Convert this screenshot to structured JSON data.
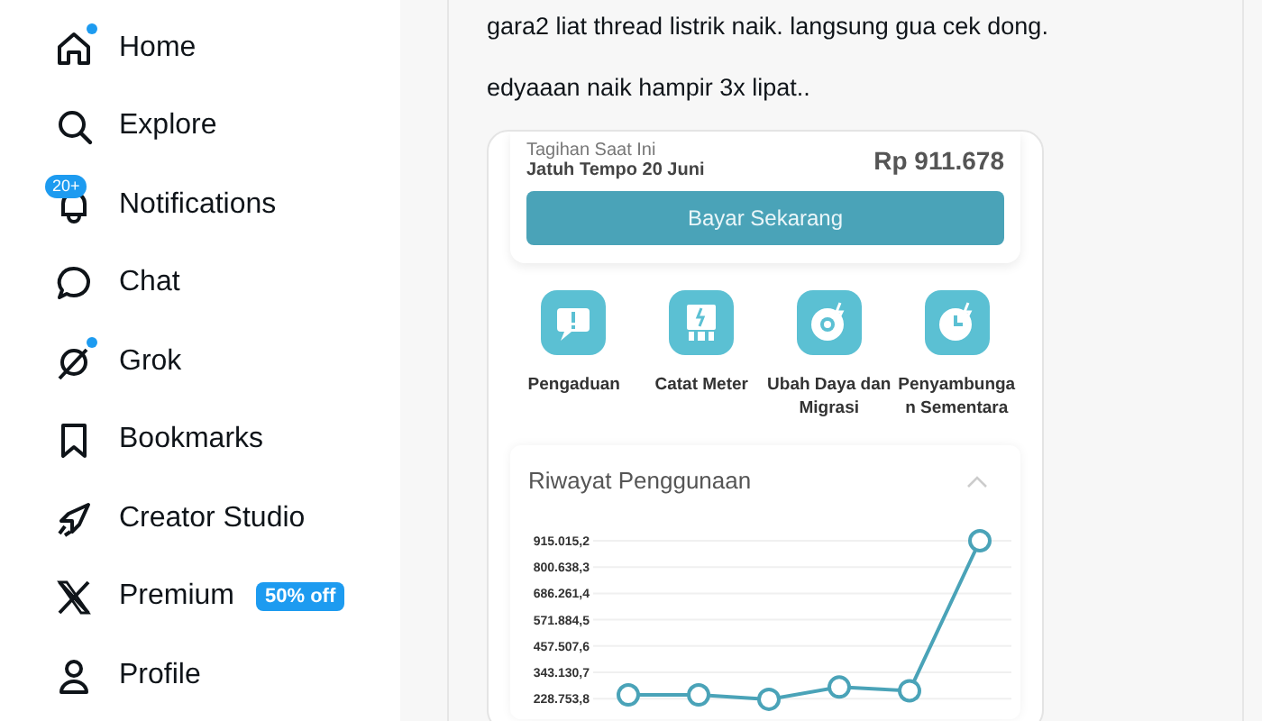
{
  "sidebar": {
    "items": [
      {
        "label": "Home",
        "dot": true
      },
      {
        "label": "Explore",
        "dot": false
      },
      {
        "label": "Notifications",
        "dot": false,
        "badge": "20+"
      },
      {
        "label": "Chat",
        "dot": false
      },
      {
        "label": "Grok",
        "dot": true
      },
      {
        "label": "Bookmarks",
        "dot": false
      },
      {
        "label": "Creator Studio",
        "dot": false
      },
      {
        "label": "Premium",
        "dot": false,
        "tag": "50% off"
      },
      {
        "label": "Profile",
        "dot": false
      }
    ]
  },
  "post": {
    "lines": [
      "gara2 liat thread listrik naik. langsung gua cek dong.",
      "edyaaan naik hampir 3x lipat.."
    ],
    "app_screenshot": {
      "bill": {
        "label": "Tagihan Saat Ini",
        "due": "Jatuh Tempo 20 Juni",
        "amount": "Rp 911.678",
        "pay_button": "Bayar Sekarang"
      },
      "menu": [
        "Pengaduan",
        "Catat Meter",
        "Ubah Daya dan Migrasi",
        "Penyambunga n Sementara"
      ],
      "usage": {
        "title": "Riwayat Penggunaan",
        "expanded": true,
        "chart_data": {
          "type": "line",
          "grid": true,
          "ylim": [
            215000,
            915015.2
          ],
          "series": [
            {
              "color": "#4aa3b8",
              "marker": "circle",
              "values": [
                245000,
                245000,
                226000,
                279000,
                263000,
                915000
              ]
            }
          ],
          "yticks": [
            {
              "value": 228753.8,
              "label": "228.753,8"
            },
            {
              "value": 343130.7,
              "label": "343.130,7"
            },
            {
              "value": 457507.6,
              "label": "457.507,6"
            },
            {
              "value": 571884.5,
              "label": "571.884,5"
            },
            {
              "value": 686261.4,
              "label": "686.261,4"
            },
            {
              "value": 800638.3,
              "label": "800.638,3"
            },
            {
              "value": 915015.2,
              "label": "915.015,2"
            }
          ]
        }
      }
    }
  }
}
